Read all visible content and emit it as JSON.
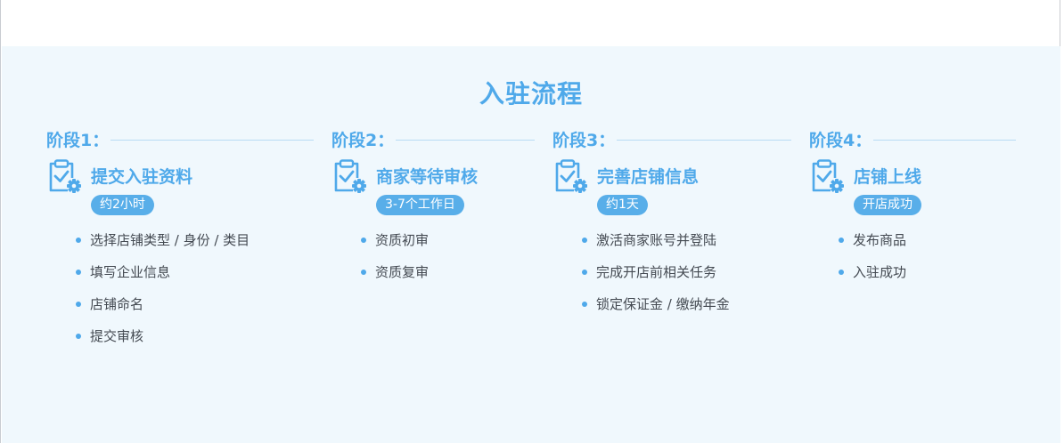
{
  "section": {
    "title": "入驻流程"
  },
  "stages": [
    {
      "label": "阶段1：",
      "icon": "clipboard-check-gear-icon",
      "name": "提交入驻资料",
      "duration": "约2小时",
      "steps": [
        "选择店铺类型 / 身份 / 类目",
        "填写企业信息",
        "店铺命名",
        "提交审核"
      ]
    },
    {
      "label": "阶段2：",
      "icon": "clipboard-check-gear-icon",
      "name": "商家等待审核",
      "duration": "3-7个工作日",
      "steps": [
        "资质初审",
        "资质复审"
      ]
    },
    {
      "label": "阶段3：",
      "icon": "clipboard-check-gear-icon",
      "name": "完善店铺信息",
      "duration": "约1天",
      "steps": [
        "激活商家账号并登陆",
        "完成开店前相关任务",
        "锁定保证金 / 缴纳年金"
      ]
    },
    {
      "label": "阶段4：",
      "icon": "clipboard-check-gear-icon",
      "name": "店铺上线",
      "duration": "开店成功",
      "steps": [
        "发布商品",
        "入驻成功"
      ]
    }
  ],
  "colors": {
    "accent": "#4fa9ea",
    "badge": "#58aee9",
    "panel_bg": "#f0f8fd",
    "text": "#444a52",
    "line": "#b8dcf4"
  }
}
